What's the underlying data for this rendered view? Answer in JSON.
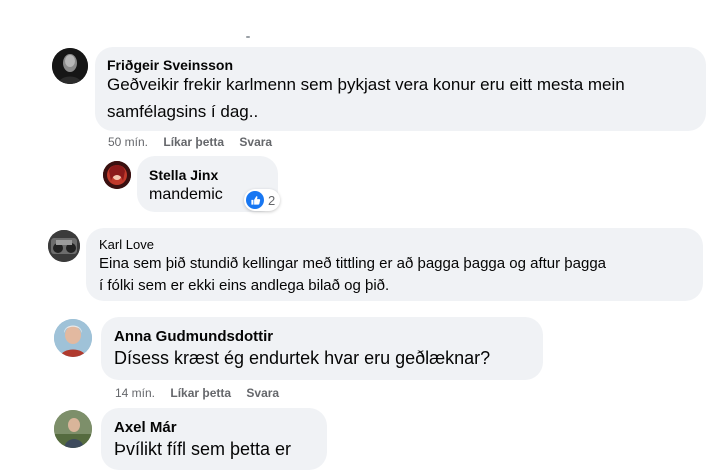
{
  "comments": [
    {
      "author": "Friðgeir Sveinsson",
      "lines": [
        "Geðveikir frekir karlmenn sem þykjast vera konur eru eitt mesta mein",
        "samfélagsins í dag.."
      ],
      "meta": {
        "time": "50 mín.",
        "like": "Líkar þetta",
        "reply": "Svara"
      }
    },
    {
      "author": "Stella Jinx",
      "lines": [
        "mandemic"
      ],
      "reactions": {
        "icon": "like-icon",
        "count": "2",
        "color": "#1877f2"
      }
    },
    {
      "author": "Karl Love",
      "lines": [
        "Eina sem þið stundið kellingar með tittling er að þagga þagga og aftur þagga",
        "í fólki sem er ekki eins andlega bilað og þið."
      ]
    },
    {
      "author": "Anna Gudmundsdottir",
      "lines": [
        "Dísess kræst ég endurtek hvar eru geðlæknar?"
      ],
      "meta": {
        "time": "14 mín.",
        "like": "Líkar þetta",
        "reply": "Svara"
      }
    },
    {
      "author": "Axel Már",
      "lines": [
        "Þvílikt fífl sem þetta er"
      ]
    }
  ],
  "colors": {
    "bubble": "#f0f2f5",
    "meta_text": "#65676b",
    "like_blue": "#1877f2"
  }
}
